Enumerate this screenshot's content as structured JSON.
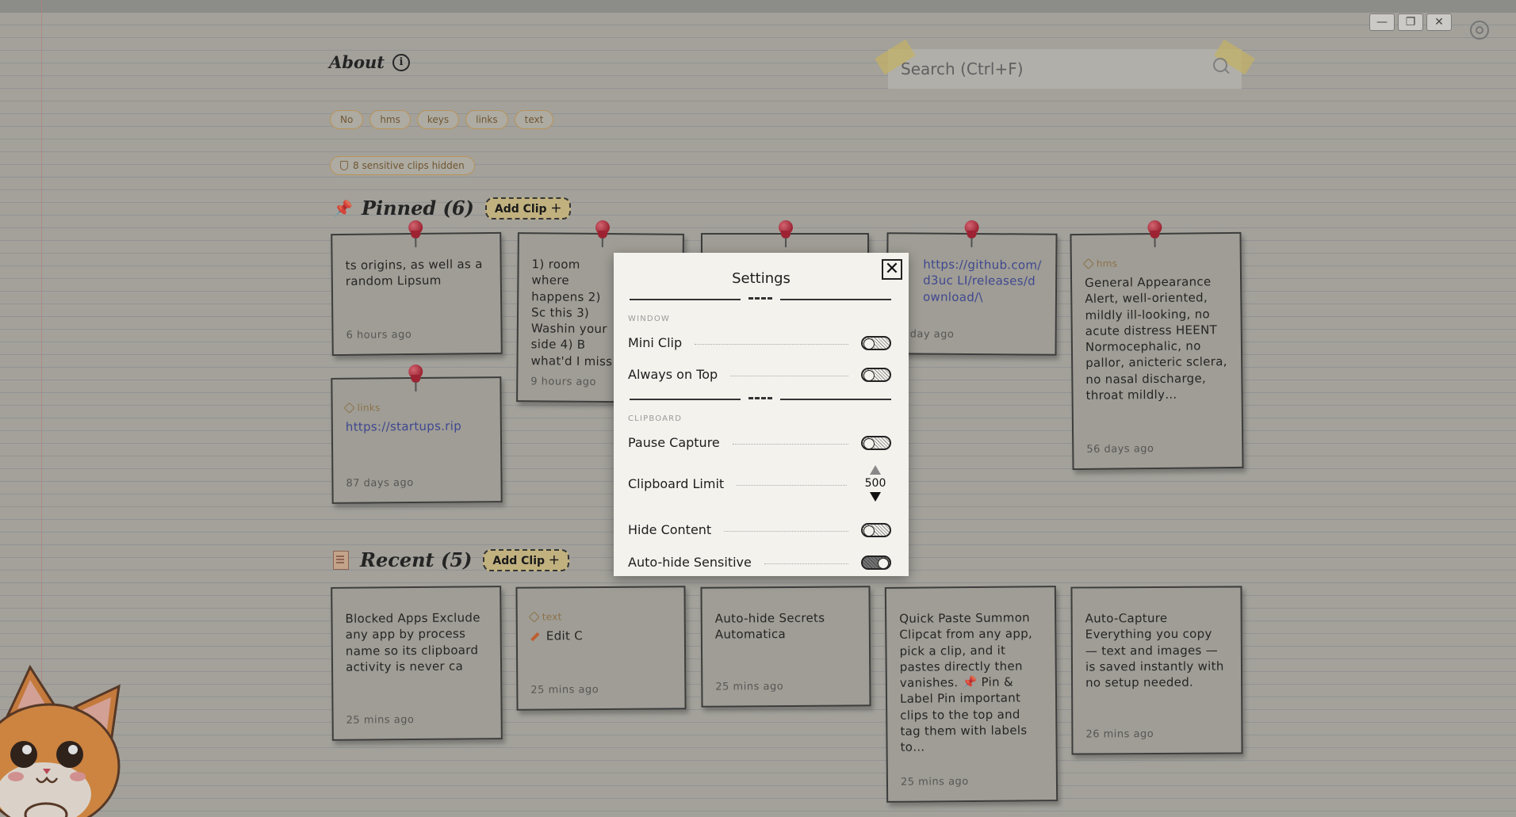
{
  "window_controls": {
    "minimize": "—",
    "restore": "❐",
    "close": "✕"
  },
  "header": {
    "about_label": "About",
    "info_glyph": "i"
  },
  "search": {
    "placeholder": "Search (Ctrl+F)"
  },
  "tags": [
    "No",
    "hms",
    "keys",
    "links",
    "text"
  ],
  "sensitive_notice": "8 sensitive clips hidden",
  "pinned": {
    "title": "Pinned (6)",
    "add_clip": "Add Clip ＋",
    "cards": [
      {
        "text": "ts origins, as well as a random Lipsum",
        "time": "6 hours ago"
      },
      {
        "text": "1) room where happens 2) Sc this 3) Washin your side 4) B what'd I miss",
        "time": "9 hours ago"
      },
      {
        "text": "",
        "time": ""
      },
      {
        "link": "https://github.com/d3uc LI/releases/download/\\",
        "time": "day ago"
      },
      {
        "label": "hms",
        "text": "General Appearance Alert, well-oriented, mildly ill-looking, no acute distress HEENT Normocephalic, no pallor, anicteric sclera, no nasal discharge, throat mildly…",
        "time": "56 days ago"
      },
      {
        "label": "links",
        "link": "https://startups.rip",
        "time": "87 days ago"
      }
    ]
  },
  "recent": {
    "title": "Recent (5)",
    "add_clip": "Add Clip ＋",
    "cards": [
      {
        "text": "Blocked Apps Exclude any app by process name so its clipboard activity is never ca",
        "time": "25 mins ago"
      },
      {
        "label": "text",
        "text": "Edit C",
        "time": "25 mins ago"
      },
      {
        "text": "Auto-hide Secrets Automatica",
        "time": "25 mins ago"
      },
      {
        "text": "Quick Paste Summon Clipcat from any app, pick a clip, and it pastes directly then vanishes. 📌 Pin & Label Pin important clips to the top and tag them with labels to…",
        "time": "25 mins ago"
      },
      {
        "text": "Auto-Capture Everything you copy — text and images — is saved instantly with no setup needed.",
        "time": "26 mins ago"
      }
    ]
  },
  "settings": {
    "title": "Settings",
    "close_glyph": "✕",
    "window_group": "WINDOW",
    "clipboard_group": "CLIPBOARD",
    "mini_clip": {
      "label": "Mini Clip",
      "enabled": false
    },
    "always_on_top": {
      "label": "Always on Top",
      "enabled": false
    },
    "pause_capture": {
      "label": "Pause Capture",
      "enabled": false
    },
    "clipboard_limit": {
      "label": "Clipboard Limit",
      "value": "500"
    },
    "hide_content": {
      "label": "Hide Content",
      "enabled": false
    },
    "auto_hide_sensitive": {
      "label": "Auto-hide Sensitive",
      "enabled": true
    }
  }
}
